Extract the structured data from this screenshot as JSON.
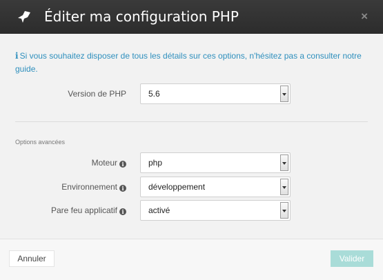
{
  "header": {
    "title": "Éditer ma configuration PHP",
    "close_label": "×",
    "logo_icon": "rocket-icon"
  },
  "info": {
    "icon_glyph": "i",
    "text": "Si vous souhaitez disposer de tous les détails sur ces options, n'hésitez pas a consulter notre guide."
  },
  "php_version": {
    "label": "Version de PHP",
    "value": "5.6"
  },
  "advanced": {
    "section_title": "Options avancées",
    "help_glyph": "i",
    "engine": {
      "label": "Moteur",
      "value": "php"
    },
    "environment": {
      "label": "Environnement",
      "value": "développement"
    },
    "firewall": {
      "label": "Pare feu applicatif",
      "value": "activé"
    }
  },
  "footer": {
    "cancel_label": "Annuler",
    "submit_label": "Valider"
  },
  "colors": {
    "header_bg": "#2f2f2f",
    "info_text": "#2e8fbd",
    "submit_bg": "#a9dcd8"
  }
}
